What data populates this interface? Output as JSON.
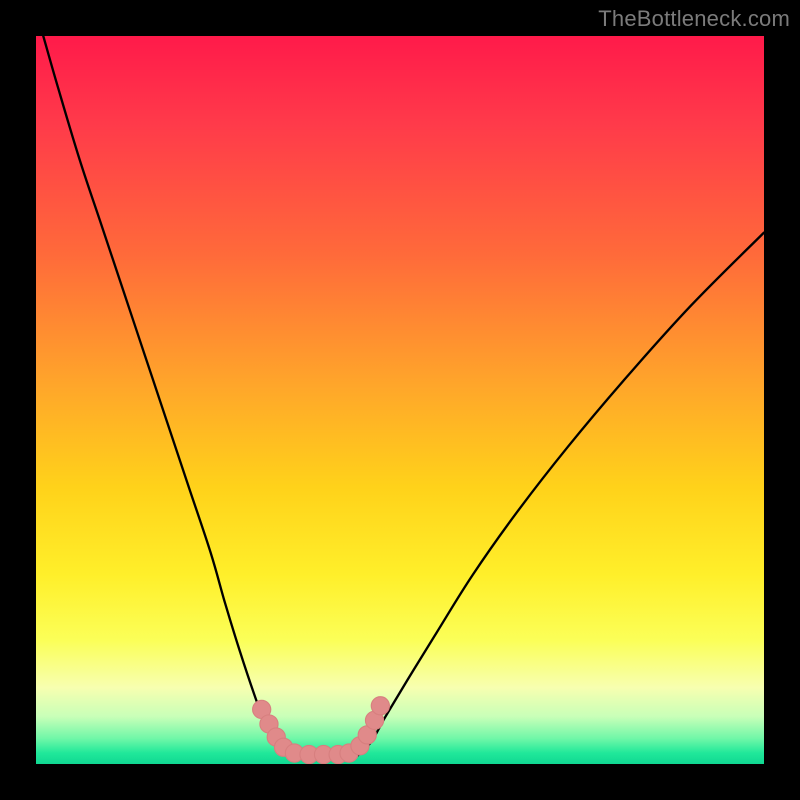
{
  "watermark": "TheBottleneck.com",
  "colors": {
    "page_bg": "#000000",
    "watermark": "#7b7b7b",
    "curve": "#000000",
    "marker_fill": "#e08a8a",
    "marker_stroke": "#d77f7f"
  },
  "gradient": {
    "stops": [
      {
        "offset": 0.0,
        "color": "#ff1a4a"
      },
      {
        "offset": 0.12,
        "color": "#ff3a4a"
      },
      {
        "offset": 0.3,
        "color": "#ff6a3a"
      },
      {
        "offset": 0.48,
        "color": "#ffa62a"
      },
      {
        "offset": 0.62,
        "color": "#ffd21a"
      },
      {
        "offset": 0.74,
        "color": "#ffef2a"
      },
      {
        "offset": 0.83,
        "color": "#fbff58"
      },
      {
        "offset": 0.895,
        "color": "#f7ffb0"
      },
      {
        "offset": 0.935,
        "color": "#c8ffb8"
      },
      {
        "offset": 0.965,
        "color": "#70f7a8"
      },
      {
        "offset": 0.985,
        "color": "#20e89a"
      },
      {
        "offset": 1.0,
        "color": "#10d892"
      }
    ]
  },
  "chart_data": {
    "type": "line",
    "title": "",
    "xlabel": "",
    "ylabel": "",
    "xlim": [
      0,
      100
    ],
    "ylim": [
      0,
      100
    ],
    "grid": false,
    "legend": false,
    "series": [
      {
        "name": "left-curve",
        "x": [
          1,
          3,
          6,
          9,
          12,
          15,
          18,
          21,
          24,
          26,
          28,
          30,
          31.5,
          33,
          34,
          35
        ],
        "y": [
          100,
          93,
          83,
          74,
          65,
          56,
          47,
          38,
          29,
          22,
          15.5,
          9.5,
          5.5,
          3,
          1.5,
          1
        ]
      },
      {
        "name": "valley-floor",
        "x": [
          35,
          37,
          39.5,
          42,
          44
        ],
        "y": [
          1,
          0.8,
          0.8,
          0.8,
          1
        ]
      },
      {
        "name": "right-curve",
        "x": [
          44,
          46,
          48,
          51,
          55,
          60,
          66,
          73,
          81,
          90,
          100
        ],
        "y": [
          1,
          3,
          6.5,
          11.5,
          18,
          26,
          34.5,
          43.5,
          53,
          63,
          73
        ]
      }
    ],
    "markers": {
      "name": "bottleneck-zone",
      "points": [
        {
          "x": 31.0,
          "y": 7.5
        },
        {
          "x": 32.0,
          "y": 5.5
        },
        {
          "x": 33.0,
          "y": 3.7
        },
        {
          "x": 34.0,
          "y": 2.3
        },
        {
          "x": 35.5,
          "y": 1.5
        },
        {
          "x": 37.5,
          "y": 1.3
        },
        {
          "x": 39.5,
          "y": 1.3
        },
        {
          "x": 41.5,
          "y": 1.3
        },
        {
          "x": 43.0,
          "y": 1.5
        },
        {
          "x": 44.5,
          "y": 2.5
        },
        {
          "x": 45.5,
          "y": 4.0
        },
        {
          "x": 46.5,
          "y": 6.0
        },
        {
          "x": 47.3,
          "y": 8.0
        }
      ]
    }
  }
}
